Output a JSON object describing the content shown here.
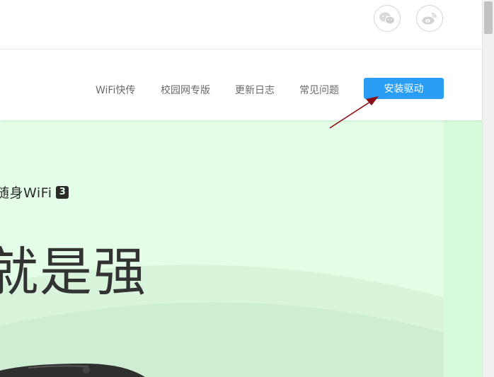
{
  "nav": {
    "items": [
      {
        "label": "WiFi快传"
      },
      {
        "label": "校园网专版"
      },
      {
        "label": "更新日志"
      },
      {
        "label": "常见问题"
      }
    ],
    "install_label": "安装驱动"
  },
  "hero": {
    "brand_text": "随身WiFi",
    "brand_badge": "3",
    "slogan": "就是强"
  },
  "icons": {
    "social": [
      "wechat-icon",
      "weibo-icon"
    ]
  },
  "colors": {
    "accent": "#2a9df4",
    "hero_bg": "#e3fde6",
    "annotation_arrow": "#8b0f14"
  }
}
